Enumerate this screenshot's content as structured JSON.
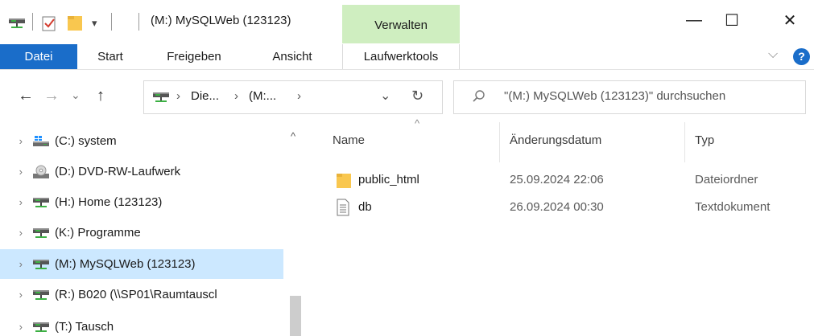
{
  "window": {
    "title": "(M:) MySQLWeb (123123)",
    "context_tab_group": "Verwalten",
    "minimize_glyph": "—",
    "maximize_glyph": "☐",
    "close_glyph": "✕",
    "qa_dropdown_glyph": "▾"
  },
  "ribbon": {
    "tabs": [
      {
        "label": "Datei"
      },
      {
        "label": "Start"
      },
      {
        "label": "Freigeben"
      },
      {
        "label": "Ansicht"
      },
      {
        "label": "Laufwerktools"
      }
    ],
    "expand_glyph": "⌵",
    "help_glyph": "?",
    "accent": "#1a6dc9",
    "context_color": "#cfeec0"
  },
  "address": {
    "back_glyph": "←",
    "forward_glyph": "→",
    "recent_glyph": "⌄",
    "up_glyph": "↑",
    "crumbs": [
      "Die...",
      "(M:..."
    ],
    "crumb_sep": "›",
    "dropdown_glyph": "⌄",
    "refresh_glyph": "↻",
    "search_placeholder": "\"(M:) MySQLWeb (123123)\" durchsuchen",
    "search_icon": "search-icon"
  },
  "nav": {
    "items": [
      {
        "label": "(C:) system",
        "icon": "windows-drive-icon",
        "selected": false
      },
      {
        "label": "(D:) DVD-RW-Laufwerk",
        "icon": "dvd-drive-icon",
        "selected": false
      },
      {
        "label": "(H:) Home (123123)",
        "icon": "network-drive-icon",
        "selected": false
      },
      {
        "label": "(K:) Programme",
        "icon": "network-drive-icon",
        "selected": false
      },
      {
        "label": "(M:) MySQLWeb (123123)",
        "icon": "network-drive-icon",
        "selected": true
      },
      {
        "label": "(R:) B020 (\\\\SP01\\Raumtauscl",
        "icon": "network-drive-icon",
        "selected": false
      },
      {
        "label": "(T:) Tausch",
        "icon": "network-drive-icon",
        "selected": false
      }
    ],
    "chevron_glyph": "›",
    "selected_color": "#cce8ff",
    "scroll_up_glyph": "^"
  },
  "list": {
    "columns": [
      {
        "label": "Name"
      },
      {
        "label": "Änderungsdatum"
      },
      {
        "label": "Typ"
      }
    ],
    "sort_glyph": "^",
    "rows": [
      {
        "name": "public_html",
        "date": "25.09.2024 22:06",
        "type": "Dateiordner",
        "icon": "folder-icon"
      },
      {
        "name": "db",
        "date": "26.09.2024 00:30",
        "type": "Textdokument",
        "icon": "text-document-icon"
      }
    ]
  }
}
